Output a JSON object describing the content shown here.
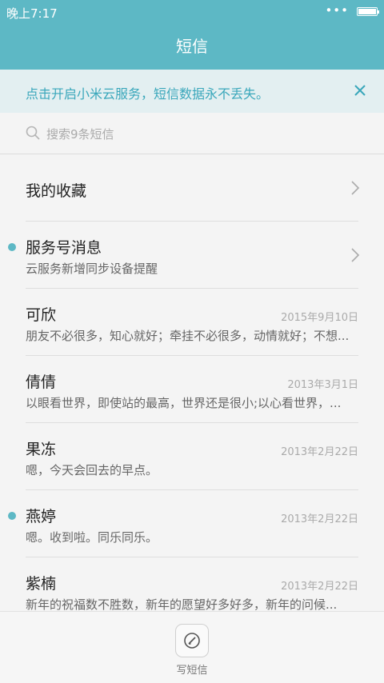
{
  "status": {
    "time": "晚上7:17",
    "dots": "•••"
  },
  "header": {
    "title": "短信"
  },
  "banner": {
    "text": "点击开启小米云服务，短信数据永不丢失。",
    "close_icon": "close-icon"
  },
  "search": {
    "placeholder": "搜索9条短信"
  },
  "favorites": {
    "label": "我的收藏"
  },
  "conversations": [
    {
      "name": "服务号消息",
      "snippet": "云服务新增同步设备提醒",
      "date": "",
      "unread": true,
      "chevron": true
    },
    {
      "name": "可欣",
      "snippet": "朋友不必很多，知心就好；牵挂不必很多，动情就好；不想...",
      "date": "2015年9月10日",
      "unread": false
    },
    {
      "name": "倩倩",
      "snippet": "以眼看世界，即使站的最高，世界还是很小;以心看世界，...",
      "date": "2013年3月1日",
      "unread": false
    },
    {
      "name": "果冻",
      "snippet": "嗯，今天会回去的早点。",
      "date": "2013年2月22日",
      "unread": false
    },
    {
      "name": "燕婷",
      "snippet": "嗯。收到啦。同乐同乐。",
      "date": "2013年2月22日",
      "unread": true
    },
    {
      "name": "紫楠",
      "snippet": "新年的祝福数不胜数，新年的愿望好多好多，新年的问候...",
      "date": "2013年2月22日",
      "unread": false
    }
  ],
  "compose": {
    "label": "写短信"
  },
  "colors": {
    "accent": "#5db8c5",
    "banner_bg": "#e3eff1",
    "banner_text": "#3aa7bb"
  }
}
